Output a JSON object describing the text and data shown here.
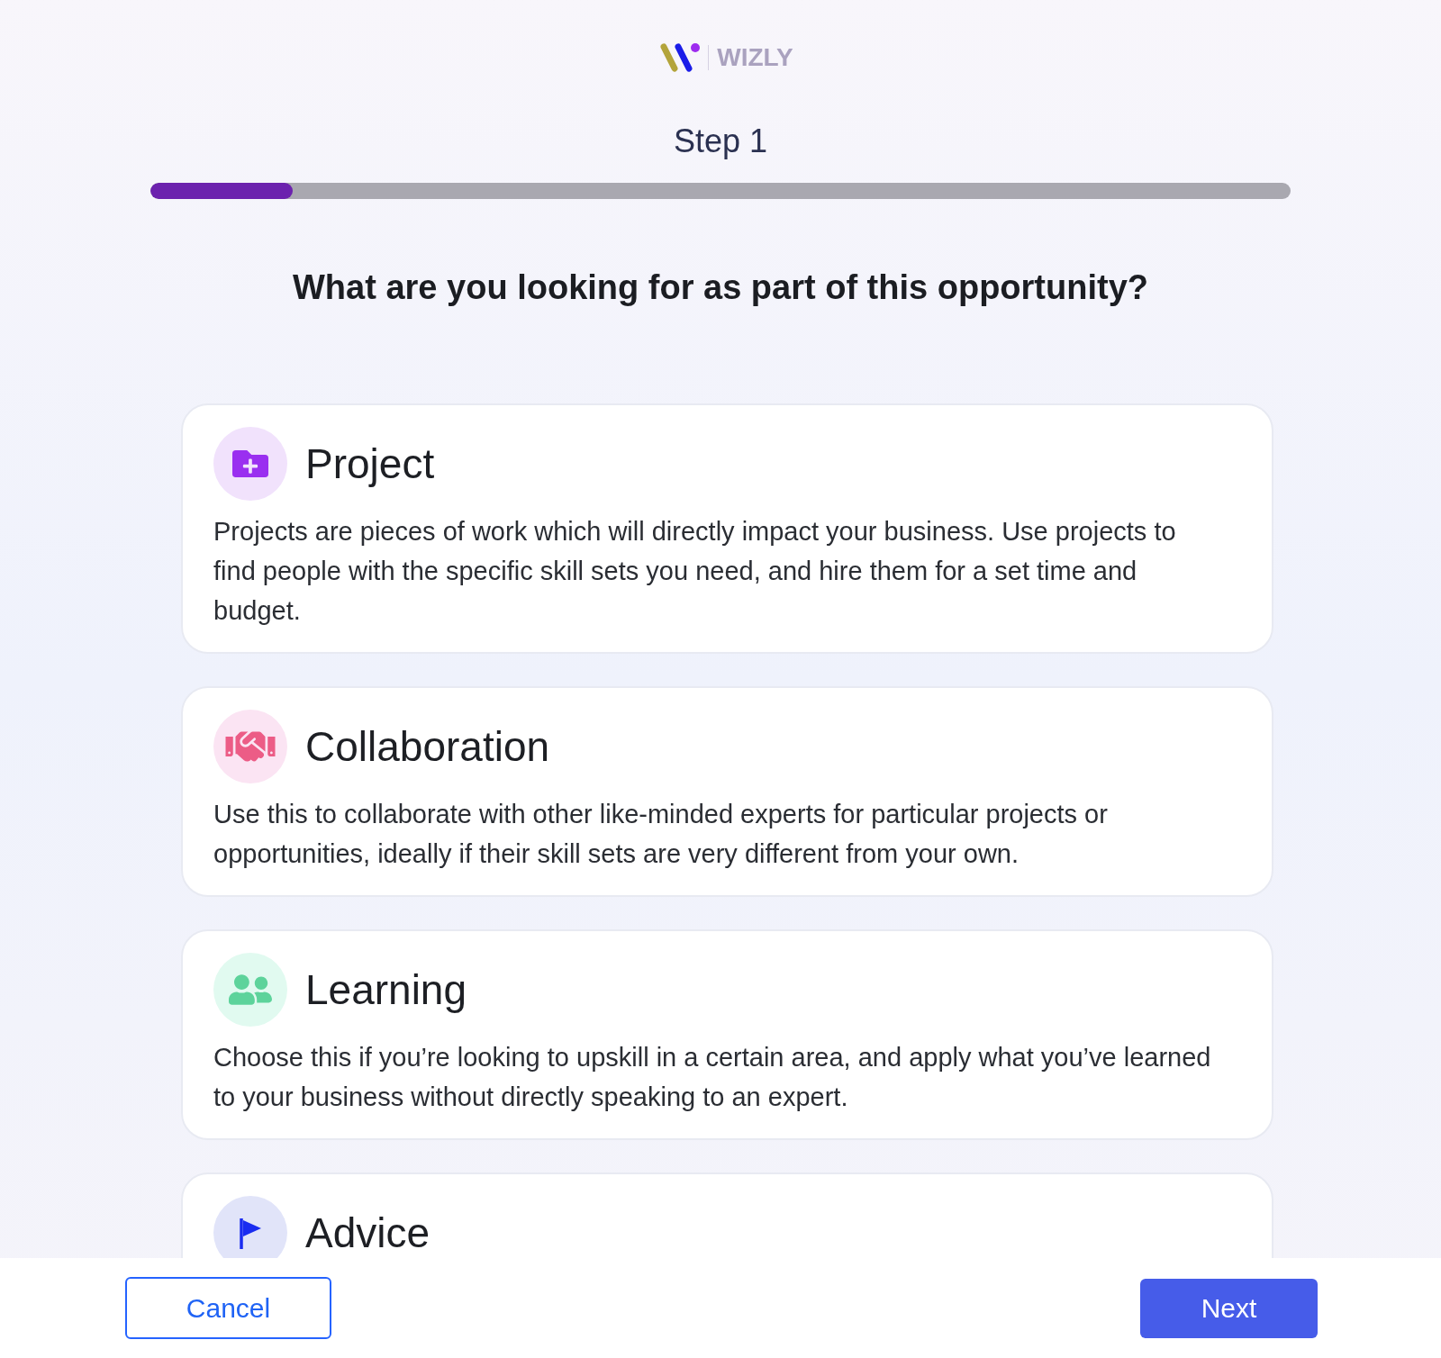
{
  "logo": {
    "wordmark": "WIZLY"
  },
  "step": {
    "label": "Step 1",
    "level": 0.125
  },
  "question": "What are you looking for as part of this opportunity?",
  "options": [
    {
      "kind": "project",
      "title": "Project",
      "description": "Projects are pieces of work which will directly impact your business. Use projects to find people with the specific skill sets you need, and hire them for a set time and budget."
    },
    {
      "kind": "collaboration",
      "title": "Collaboration",
      "description": "Use this to collaborate with other like-minded experts for particular projects or opportunities, ideally if their skill sets are very different from your own."
    },
    {
      "kind": "learning",
      "title": "Learning",
      "description": "Choose this if you’re looking to upskill in a certain area, and apply what you’ve learned to your business without directly speaking to an expert."
    },
    {
      "kind": "advice",
      "title": "Advice"
    }
  ],
  "buttons": [
    {
      "kind": "secondary",
      "label": "Cancel"
    },
    {
      "kind": "primary",
      "label": "Next"
    }
  ]
}
